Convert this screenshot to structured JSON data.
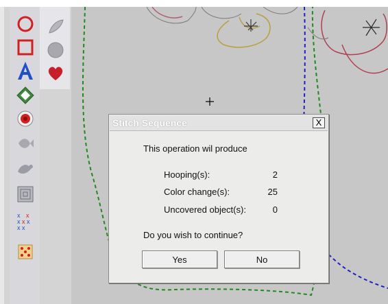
{
  "dialog": {
    "title": "Stitch Sequence",
    "close_label": "X",
    "message": "This operation wil produce",
    "rows": [
      {
        "label": "Hooping(s):",
        "value": "2"
      },
      {
        "label": "Color change(s):",
        "value": "25"
      },
      {
        "label": "Uncovered object(s):",
        "value": "0"
      }
    ],
    "question": "Do you wish to continue?",
    "yes_label": "Yes",
    "no_label": "No"
  },
  "toolbar": {
    "tools": [
      {
        "icon": "circle-icon"
      },
      {
        "icon": "square-icon"
      },
      {
        "icon": "text-a-icon"
      },
      {
        "icon": "abc-diamond-icon"
      },
      {
        "icon": "rose-icon"
      },
      {
        "icon": "fish-icon"
      },
      {
        "icon": "bird-icon"
      },
      {
        "icon": "concentric-square-icon"
      },
      {
        "icon": "cross-stitch-icon"
      },
      {
        "icon": "dots-tile-icon"
      },
      {
        "icon": "feather-icon"
      },
      {
        "icon": "gray-circle-icon"
      },
      {
        "icon": "heart-icon"
      }
    ]
  },
  "colors": {
    "green_dash": "#1e8a1e",
    "blue_dash": "#2020c8",
    "red_tool": "#d02020",
    "blue_tool": "#1e50c8"
  }
}
